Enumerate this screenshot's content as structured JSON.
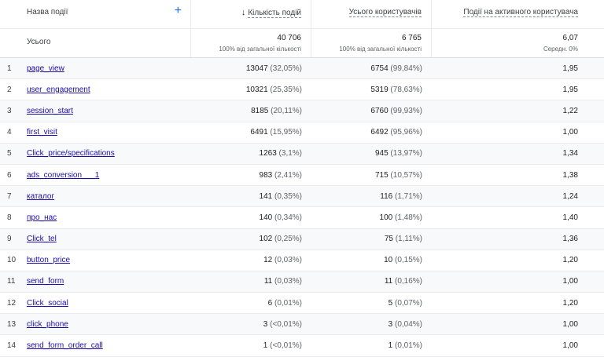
{
  "header": {
    "event_name": "Назва події",
    "add_icon": "+",
    "sort_arrow": "↓",
    "col1": "Кількість подій",
    "col2": "Усього користувачів",
    "col3": "Події на активного користувача"
  },
  "totals": {
    "label": "Усього",
    "col1_value": "40 706",
    "col1_sub": "100% від загальної кількості",
    "col2_value": "6 765",
    "col2_sub": "100% від загальної кількості",
    "col3_value": "6,07",
    "col3_sub": "Середн. 0%"
  },
  "rows": [
    {
      "idx": "1",
      "name": "page_view",
      "count": "13047",
      "count_pct": "(32,05%)",
      "users": "6754",
      "users_pct": "(99,84%)",
      "per_user": "1,95"
    },
    {
      "idx": "2",
      "name": "user_engagement",
      "count": "10321",
      "count_pct": "(25,35%)",
      "users": "5319",
      "users_pct": "(78,63%)",
      "per_user": "1,95"
    },
    {
      "idx": "3",
      "name": "session_start",
      "count": "8185",
      "count_pct": "(20,11%)",
      "users": "6760",
      "users_pct": "(99,93%)",
      "per_user": "1,22"
    },
    {
      "idx": "4",
      "name": "first_visit",
      "count": "6491",
      "count_pct": "(15,95%)",
      "users": "6492",
      "users_pct": "(95,96%)",
      "per_user": "1,00"
    },
    {
      "idx": "5",
      "name": "Click_price/specifications",
      "count": "1263",
      "count_pct": "(3,1%)",
      "users": "945",
      "users_pct": "(13,97%)",
      "per_user": "1,34"
    },
    {
      "idx": "6",
      "name": "ads_conversion___1",
      "count": "983",
      "count_pct": "(2,41%)",
      "users": "715",
      "users_pct": "(10,57%)",
      "per_user": "1,38"
    },
    {
      "idx": "7",
      "name": "каталог",
      "count": "141",
      "count_pct": "(0,35%)",
      "users": "116",
      "users_pct": "(1,71%)",
      "per_user": "1,24"
    },
    {
      "idx": "8",
      "name": "про_нас",
      "count": "140",
      "count_pct": "(0,34%)",
      "users": "100",
      "users_pct": "(1,48%)",
      "per_user": "1,40"
    },
    {
      "idx": "9",
      "name": "Click_tel",
      "count": "102",
      "count_pct": "(0,25%)",
      "users": "75",
      "users_pct": "(1,11%)",
      "per_user": "1,36"
    },
    {
      "idx": "10",
      "name": "button_price",
      "count": "12",
      "count_pct": "(0,03%)",
      "users": "10",
      "users_pct": "(0,15%)",
      "per_user": "1,20"
    },
    {
      "idx": "11",
      "name": "send_form",
      "count": "11",
      "count_pct": "(0,03%)",
      "users": "11",
      "users_pct": "(0,16%)",
      "per_user": "1,00"
    },
    {
      "idx": "12",
      "name": "Click_social",
      "count": "6",
      "count_pct": "(0,01%)",
      "users": "5",
      "users_pct": "(0,07%)",
      "per_user": "1,20"
    },
    {
      "idx": "13",
      "name": "click_phone",
      "count": "3",
      "count_pct": "(<0,01%)",
      "users": "3",
      "users_pct": "(0,04%)",
      "per_user": "1,00"
    },
    {
      "idx": "14",
      "name": "send_form_order_call",
      "count": "1",
      "count_pct": "(<0,01%)",
      "users": "1",
      "users_pct": "(0,01%)",
      "per_user": "1,00"
    }
  ]
}
